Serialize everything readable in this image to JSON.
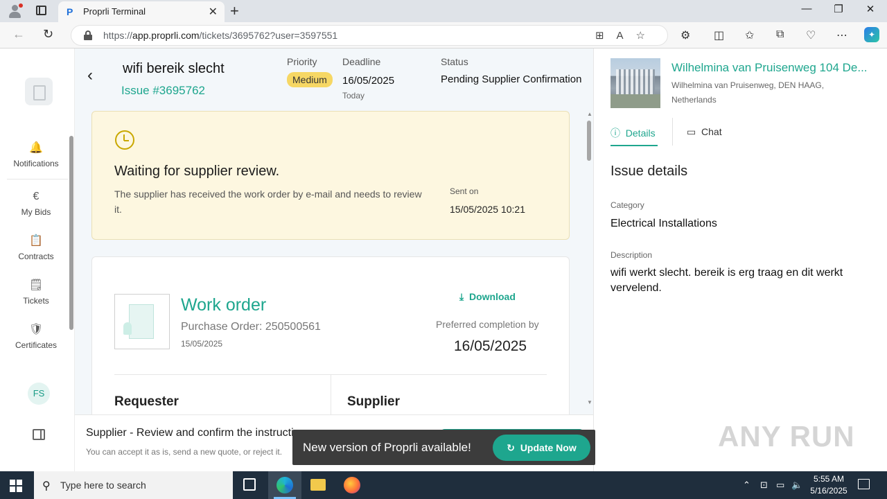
{
  "browser": {
    "tab_title": "Proprli Terminal",
    "url_prefix": "https://",
    "url_domain": "app.proprli.com",
    "url_path": "/tickets/3695762?user=3597551",
    "tab_close": "✕",
    "new_tab": "+",
    "minimize": "—",
    "maximize": "❐",
    "close": "✕"
  },
  "leftnav": {
    "items": [
      {
        "label": "Notifications",
        "icon": "🔔"
      },
      {
        "label": "My Bids",
        "icon": "€"
      },
      {
        "label": "Contracts",
        "icon": "📋"
      },
      {
        "label": "Tickets",
        "icon": "🗒"
      },
      {
        "label": "Certificates",
        "icon": "🛡"
      }
    ],
    "avatar_initials": "FS"
  },
  "header": {
    "title": "wifi bereik slecht",
    "issue_number": "Issue #3695762",
    "priority_label": "Priority",
    "priority_value": "Medium",
    "deadline_label": "Deadline",
    "deadline_value": "16/05/2025",
    "deadline_sub": "Today",
    "status_label": "Status",
    "status_value": "Pending Supplier Confirmation"
  },
  "alert": {
    "title": "Waiting for supplier review.",
    "text": "The supplier has received the work order by e-mail and needs to review it.",
    "sent_label": "Sent on",
    "sent_value": "15/05/2025 10:21"
  },
  "work_order": {
    "title": "Work order",
    "purchase_order": "Purchase Order: 250500561",
    "date": "15/05/2025",
    "download_label": "Download",
    "preferred_label": "Preferred completion by",
    "preferred_value": "16/05/2025",
    "requester_heading": "Requester",
    "supplier_heading": "Supplier"
  },
  "bottom_bar": {
    "title": "Supplier - Review and confirm the instructi",
    "subtitle": "You can accept it as is, send a new quote, or reject it."
  },
  "toast": {
    "text": "New version of Proprli available!",
    "button_label": "Update Now"
  },
  "property": {
    "title": "Wilhelmina van Pruisenweg 104 De...",
    "address": "Wilhelmina van Pruisenweg, DEN HAAG, Netherlands"
  },
  "right_tabs": {
    "details": "Details",
    "chat": "Chat"
  },
  "details": {
    "heading": "Issue details",
    "category_label": "Category",
    "category_value": "Electrical Installations",
    "description_label": "Description",
    "description_value": "wifi werkt slecht. bereik is erg traag en dit werkt vervelend."
  },
  "watermark": "ANY RUN",
  "taskbar": {
    "search_placeholder": "Type here to search",
    "time": "5:55 AM",
    "date": "5/16/2025"
  },
  "colors": {
    "accent": "#1ea68e",
    "priority_badge": "#f6d764",
    "alert_bg": "#fdf7e0",
    "taskbar": "#1f2e3d"
  }
}
